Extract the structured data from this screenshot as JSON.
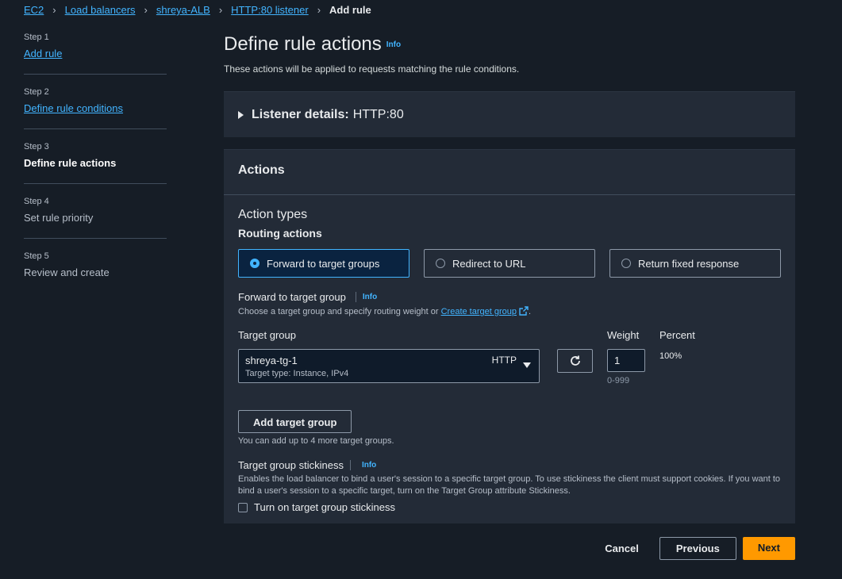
{
  "breadcrumb": {
    "items": [
      "EC2",
      "Load balancers",
      "shreya-ALB",
      "HTTP:80 listener"
    ],
    "current": "Add rule"
  },
  "steps": [
    {
      "num": "Step 1",
      "title": "Add rule"
    },
    {
      "num": "Step 2",
      "title": "Define rule conditions"
    },
    {
      "num": "Step 3",
      "title": "Define rule actions"
    },
    {
      "num": "Step 4",
      "title": "Set rule priority"
    },
    {
      "num": "Step 5",
      "title": "Review and create"
    }
  ],
  "header": {
    "title": "Define rule actions",
    "info": "Info",
    "subtitle": "These actions will be applied to requests matching the rule conditions."
  },
  "listener": {
    "label": "Listener details:",
    "value": "HTTP:80"
  },
  "actions": {
    "title": "Actions",
    "action_types": "Action types",
    "routing_actions": "Routing actions",
    "radios": [
      "Forward to target groups",
      "Redirect to URL",
      "Return fixed response"
    ],
    "selected": "Forward to target groups",
    "forward_label": "Forward to target group",
    "forward_info": "Info",
    "forward_hint_prefix": "Choose a target group and specify routing weight or ",
    "forward_hint_link": "Create target group",
    "forward_hint_suffix": ".",
    "target_group_label": "Target group",
    "target_group_name": "shreya-tg-1",
    "target_group_type": "Target type: Instance, IPv4",
    "target_group_protocol": "HTTP",
    "weight_label": "Weight",
    "weight_value": "1",
    "weight_range": "0-999",
    "percent_label": "Percent",
    "percent_value": "100%",
    "add_button": "Add target group",
    "add_hint": "You can add up to 4 more target groups.",
    "stickiness_label": "Target group stickiness",
    "stickiness_info": "Info",
    "stickiness_hint": "Enables the load balancer to bind a user's session to a specific target group. To use stickiness the client must support cookies. If you want to bind a user's session to a specific target, turn on the Target Group attribute Stickiness.",
    "stickiness_checkbox": "Turn on target group stickiness"
  },
  "footer": {
    "cancel": "Cancel",
    "previous": "Previous",
    "next": "Next"
  },
  "colors": {
    "accent": "#42b4ff",
    "primary_button": "#ff9900",
    "background": "#161d26",
    "panel": "#232b37"
  }
}
